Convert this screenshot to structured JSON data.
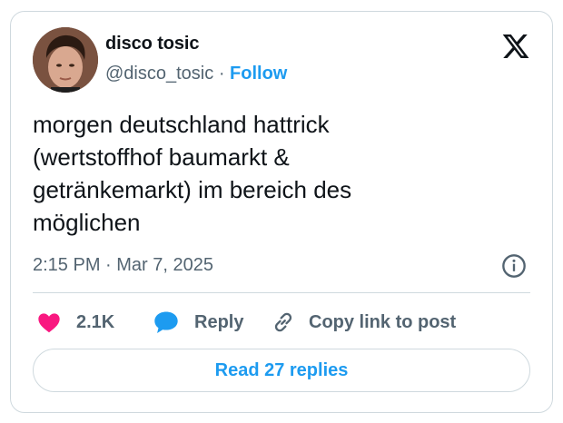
{
  "author": {
    "name": "disco tosic",
    "handle": "@disco_tosic",
    "separator": "·",
    "follow_label": "Follow"
  },
  "tweet": {
    "text": "morgen deutschland hattrick\n(wertstoffhof baumarkt &\ngetränkemarkt) im bereich des\nmöglichen",
    "timestamp": "2:15 PM · Mar 7, 2025"
  },
  "actions": {
    "like_count": "2.1K",
    "reply_label": "Reply",
    "copy_link_label": "Copy link to post"
  },
  "read_replies_label": "Read 27 replies",
  "colors": {
    "accent": "#1d9bf0",
    "like": "#f91880",
    "muted_text": "#536471",
    "border": "#cfd9de"
  },
  "icons": {
    "brand": "x-logo-icon",
    "like": "heart-icon",
    "reply": "speech-bubble-icon",
    "copy_link": "link-icon",
    "info": "info-icon"
  }
}
